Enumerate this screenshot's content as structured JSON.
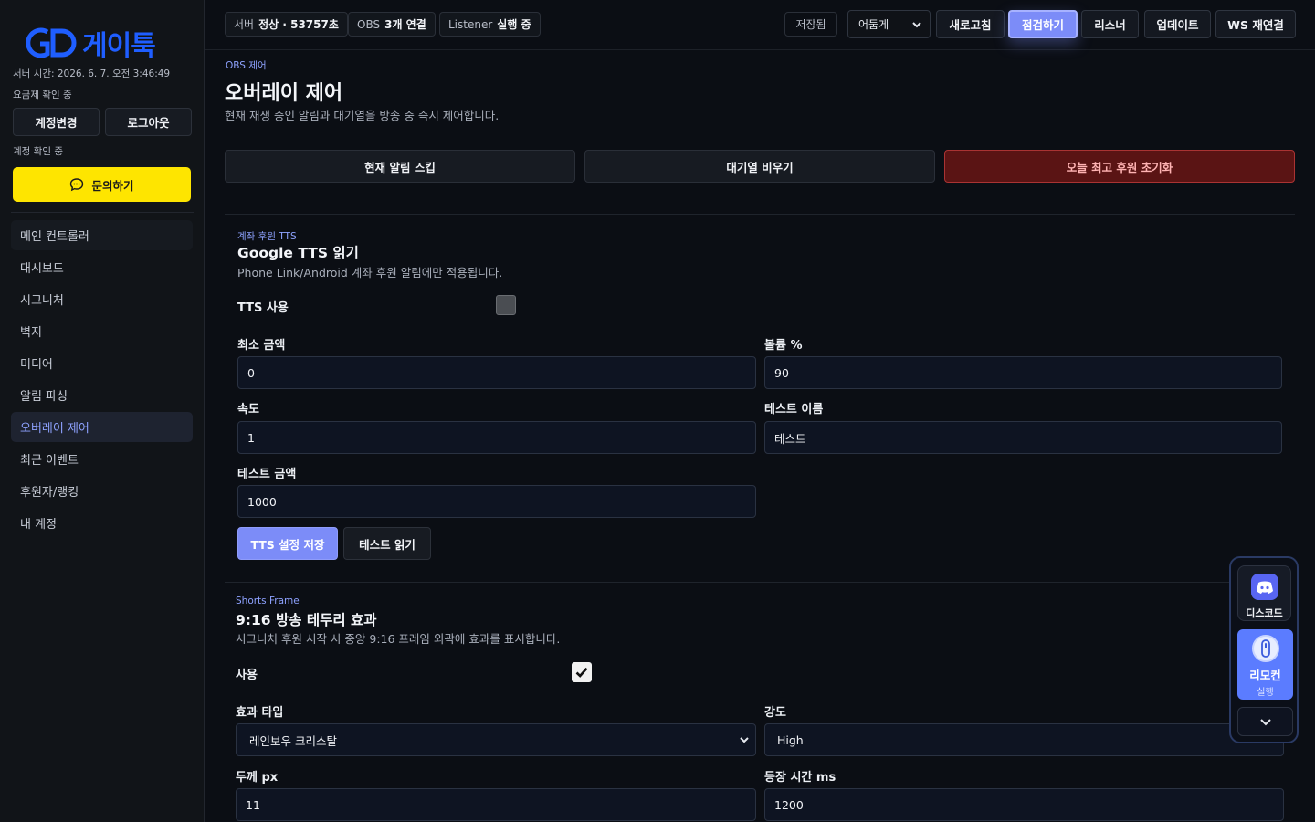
{
  "brand": {
    "logo_text": "게이툭"
  },
  "sidebar": {
    "server_time": "서버 시간: 2026. 6. 7. 오전 3:46:49",
    "billing_status": "요금제 확인 중",
    "switch_account": "계정변경",
    "logout": "로그아웃",
    "account_status": "계정 확인 중",
    "inquiry": "문의하기",
    "items": [
      {
        "label": "메인 컨트롤러"
      },
      {
        "label": "대시보드"
      },
      {
        "label": "시그니처"
      },
      {
        "label": "벽지"
      },
      {
        "label": "미디어"
      },
      {
        "label": "알림 파싱"
      },
      {
        "label": "오버레이 제어"
      },
      {
        "label": "최근 이벤트"
      },
      {
        "label": "후원자/랭킹"
      },
      {
        "label": "내 계정"
      }
    ]
  },
  "topbar": {
    "server_label": "서버",
    "server_value": "정상 · 53757초",
    "obs_label": "OBS",
    "obs_value": "3개 연결",
    "listener_label": "Listener",
    "listener_value": "실행 중",
    "saved": "저장됨",
    "theme": "어둡게",
    "refresh": "새로고침",
    "inspect": "점검하기",
    "listener_btn": "리스너",
    "update": "업데이트",
    "ws_reconnect": "WS 재연결"
  },
  "main": {
    "crumb": "OBS 제어",
    "title": "오버레이 제어",
    "desc": "현재 재생 중인 알림과 대기열을 방송 중 즉시 제어합니다.",
    "skip_alert": "현재 알림 스킵",
    "clear_queue": "대기열 비우기",
    "reset_top": "오늘 최고 후원 초기화"
  },
  "tts": {
    "tag": "계좌 후원 TTS",
    "title": "Google TTS 읽기",
    "desc": "Phone Link/Android 계좌 후원 알림에만 적용됩니다.",
    "enable_label": "TTS 사용",
    "enabled": false,
    "min_amount_label": "최소 금액",
    "min_amount": "0",
    "volume_label": "볼륨 %",
    "volume": "90",
    "speed_label": "속도",
    "speed": "1",
    "test_name_label": "테스트 이름",
    "test_name": "테스트",
    "test_amount_label": "테스트 금액",
    "test_amount": "1000",
    "save": "TTS 설정 저장",
    "test_read": "테스트 읽기"
  },
  "frame": {
    "tag": "Shorts Frame",
    "title": "9:16 방송 테두리 효과",
    "desc": "시그니처 후원 시작 시 중앙 9:16 프레임 외곽에 효과를 표시합니다.",
    "enable_label": "사용",
    "enabled": true,
    "effect_label": "효과 타입",
    "effect": "레인보우 크리스탈",
    "intensity_label": "강도",
    "intensity": "High",
    "thickness_label": "두께 px",
    "thickness": "11",
    "appear_label": "등장 시간 ms",
    "appear": "1200"
  },
  "dock": {
    "discord": "디스코드",
    "remote": "리모컨",
    "remote_sub": "실행"
  },
  "colors": {
    "accent": "#7c8cf8",
    "brand": "#1f5eff",
    "kakao": "#fee500",
    "danger": "#5a1414"
  }
}
